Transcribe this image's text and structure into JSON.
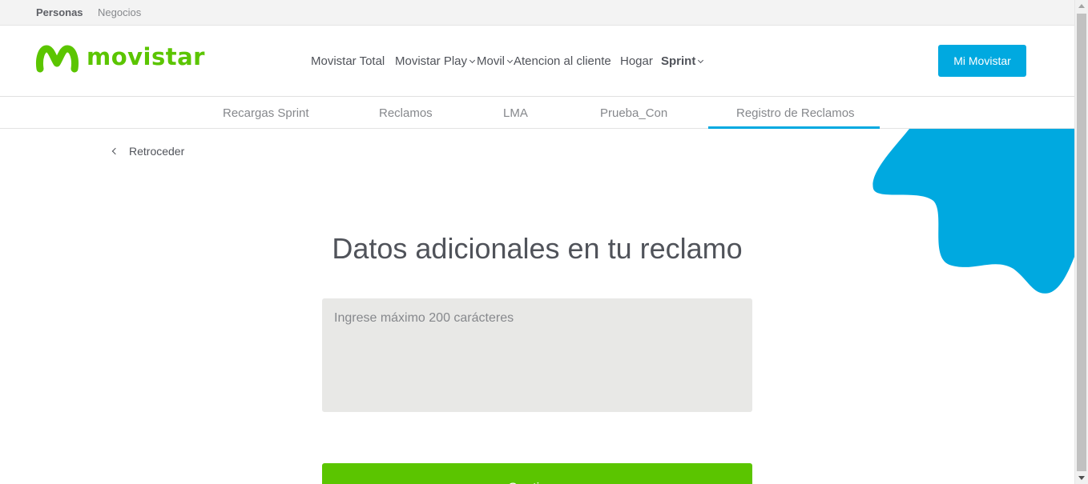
{
  "topbar": {
    "items": [
      "Personas",
      "Negocios"
    ]
  },
  "header": {
    "logo_text": "movistar",
    "nav": [
      {
        "label": "Movistar Total",
        "dropdown": false,
        "bold": false
      },
      {
        "label": "Movistar Play",
        "dropdown": true,
        "bold": false
      },
      {
        "label": "Movil",
        "dropdown": true,
        "bold": false
      },
      {
        "label": "Atencion al cliente",
        "dropdown": false,
        "bold": false
      },
      {
        "label": "Hogar",
        "dropdown": false,
        "bold": false
      },
      {
        "label": "Sprint",
        "dropdown": true,
        "bold": true
      }
    ],
    "account_button": "Mi Movistar"
  },
  "subnav": {
    "tabs": [
      "Recargas Sprint",
      "Reclamos",
      "LMA",
      "Prueba_Con",
      "Registro de Reclamos"
    ],
    "active_tab": "Registro de Reclamos"
  },
  "main": {
    "back_label": "Retroceder",
    "title": "Datos adicionales en tu reclamo",
    "textarea": {
      "placeholder": "Ingrese máximo 200 carácteres",
      "value": ""
    },
    "continue_button": "Continuar"
  },
  "colors": {
    "brand_green": "#5bc500",
    "brand_blue": "#00a9e0",
    "text": "#50535a",
    "muted": "#86888c",
    "field_bg": "#e8e8e6"
  }
}
